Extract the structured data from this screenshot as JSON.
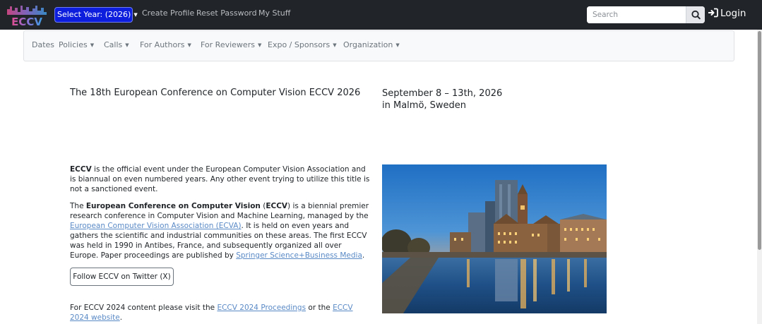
{
  "header": {
    "logo_text": "ECCV",
    "year_select": {
      "label": "Select Year: (2026)"
    },
    "links": [
      "Create Profile",
      "Reset Password",
      "My Stuff"
    ],
    "search": {
      "placeholder": "Search",
      "value": ""
    },
    "login_label": "Login"
  },
  "nav": {
    "items": [
      {
        "label": "Dates",
        "dropdown": false
      },
      {
        "label": "Policies",
        "dropdown": true
      },
      {
        "label": "Calls",
        "dropdown": true
      },
      {
        "label": "For Authors",
        "dropdown": true
      },
      {
        "label": "For Reviewers",
        "dropdown": true
      },
      {
        "label": "Expo / Sponsors",
        "dropdown": true
      },
      {
        "label": "Organization",
        "dropdown": true
      }
    ]
  },
  "main": {
    "headline": "The 18th European Conference on Computer Vision ECCV 2026",
    "dates_line1": "September 8 – 13th, 2026",
    "dates_line2": "in Malmö, Sweden",
    "intro": {
      "strong": "ECCV",
      "rest": " is the official event under the European Computer Vision Association and is biannual on even numbered years. Any other event trying to utilize this title is not a sanctioned event."
    },
    "about": {
      "t1": "The ",
      "b1": "European Conference on Computer Vision",
      "t2": " (",
      "b2": "ECCV",
      "t3": ") is a biennial premier research conference in Computer Vision and Machine Learning, managed by the ",
      "link1": "European Computer Vision Association (ECVA)",
      "t4": ". It is held on even years and gathers the scientific and industrial communities on these areas. The first ECCV was held in 1990 in Antibes, France, and subsequently organized all over Europe. Paper proceedings are published by ",
      "link2": "Springer Science+Business Media",
      "t5": "."
    },
    "twitter_button": "Follow ECCV on Twitter (X)",
    "prev": {
      "t1": "For ECCV 2024 content please visit the ",
      "link1": "ECCV 2024 Proceedings",
      "t2": " or the ",
      "link2": "ECCV 2024 website",
      "t3": "."
    }
  },
  "icons": {
    "year_caret": "caret-down-icon",
    "search": "search-icon",
    "login": "sign-in-icon"
  },
  "colors": {
    "topbar": "#212529",
    "year_button": "#0d1fdc",
    "link": "#5a8ac6",
    "nav_bg": "#f8f9fa"
  }
}
